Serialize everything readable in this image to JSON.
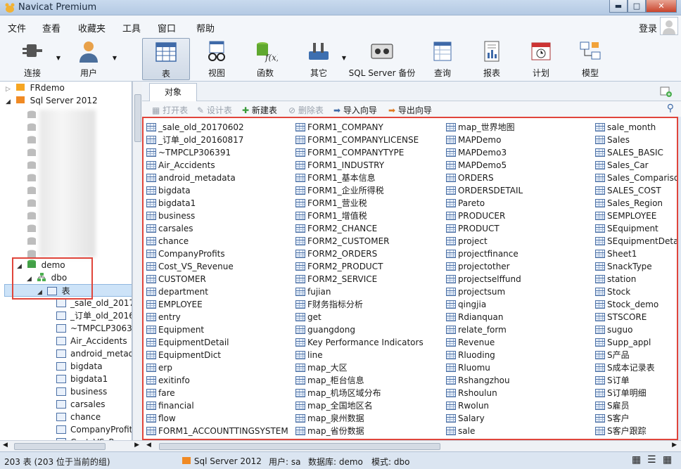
{
  "window": {
    "title": "Navicat Premium"
  },
  "menu": [
    "文件",
    "查看",
    "收藏夹",
    "工具",
    "窗口",
    "帮助"
  ],
  "login_label": "登录",
  "toolbar": {
    "connect": "连接",
    "user": "用户",
    "table": "表",
    "view": "视图",
    "function": "函数",
    "other": "其它",
    "sqlserver_backup": "SQL Server 备份",
    "query": "查询",
    "report": "报表",
    "schedule": "计划",
    "model": "模型"
  },
  "tree": {
    "frdemo": "FRdemo",
    "sqlserver": "Sql Server 2012",
    "demo": "demo",
    "dbo": "dbo",
    "tables": "表",
    "items": [
      "_sale_old_20170",
      "_订单_old_2016",
      "~TMPCLP30639",
      "Air_Accidents",
      "android_metad",
      "bigdata",
      "bigdata1",
      "business",
      "carsales",
      "chance",
      "CompanyProfit",
      "Cost_VS_R"
    ]
  },
  "objects_tab": "对象",
  "subtoolbar": {
    "open": "打开表",
    "design": "设计表",
    "new": "新建表",
    "delete": "删除表",
    "import": "导入向导",
    "export": "导出向导"
  },
  "columns": [
    [
      "_sale_old_20170602",
      "_订单_old_20160817",
      "~TMPCLP306391",
      "Air_Accidents",
      "android_metadata",
      "bigdata",
      "bigdata1",
      "business",
      "carsales",
      "chance",
      "CompanyProfits",
      "Cost_VS_Revenue",
      "CUSTOMER",
      "department",
      "EMPLOYEE",
      "entry",
      "Equipment",
      "EquipmentDetail",
      "EquipmentDict",
      "erp",
      "exitinfo",
      "fare",
      "financial",
      "flow",
      "FORM1_ACCOUNTTINGSYSTEM"
    ],
    [
      "FORM1_COMPANY",
      "FORM1_COMPANYLICENSE",
      "FORM1_COMPANYTYPE",
      "FORM1_INDUSTRY",
      "FORM1_基本信息",
      "FORM1_企业所得税",
      "FORM1_营业税",
      "FORM1_增值税",
      "FORM2_CHANCE",
      "FORM2_CUSTOMER",
      "FORM2_ORDERS",
      "FORM2_PRODUCT",
      "FORM2_SERVICE",
      "fujian",
      "F财务指标分析",
      "get",
      "guangdong",
      "Key Performance Indicators",
      "line",
      "map_大区",
      "map_柜台信息",
      "map_机场区域分布",
      "map_全国地区名",
      "map_泉州数据",
      "map_省份数据"
    ],
    [
      "map_世界地图",
      "MAPDemo",
      "MAPDemo3",
      "MAPDemo5",
      "ORDERS",
      "ORDERSDETAIL",
      "Pareto",
      "PRODUCER",
      "PRODUCT",
      "project",
      "projectfinance",
      "projectother",
      "projectselffund",
      "projectsum",
      "qingjia",
      "Rdianquan",
      "relate_form",
      "Revenue",
      "Rluoding",
      "Rluomu",
      "Rshangzhou",
      "Rshoulun",
      "Rwolun",
      "Salary",
      "sale"
    ],
    [
      "sale_month",
      "Sales",
      "SALES_BASIC",
      "Sales_Car",
      "Sales_Compariso",
      "SALES_COST",
      "Sales_Region",
      "SEMPLOYEE",
      "SEquipment",
      "SEquipmentDeta",
      "Sheet1",
      "SnackType",
      "station",
      "Stock",
      "Stock_demo",
      "STSCORE",
      "suguo",
      "Supp_appl",
      "S产品",
      "S成本记录表",
      "S订单",
      "S订单明细",
      "S雇员",
      "S客户",
      "S客户跟踪"
    ]
  ],
  "status": {
    "count": "203 表 (203 位于当前的组)",
    "connection": "Sql Server 2012",
    "user": "用户: sa",
    "database": "数据库: demo",
    "schema": "模式: dbo"
  }
}
